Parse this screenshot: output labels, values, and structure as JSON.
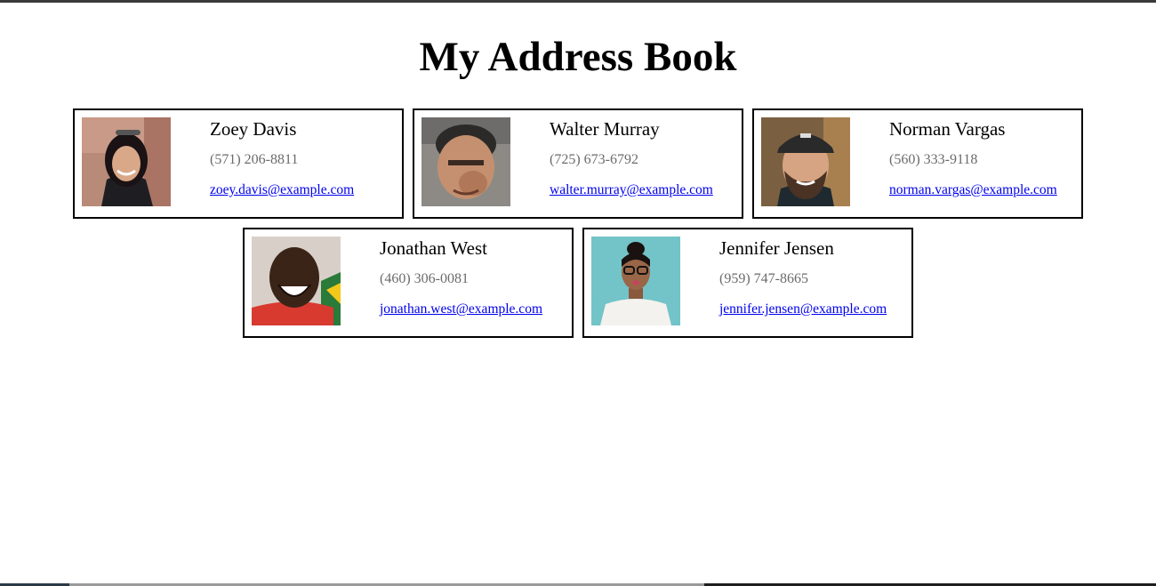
{
  "page": {
    "title": "My Address Book"
  },
  "contacts": [
    {
      "name": "Zoey Davis",
      "phone": "(571) 206-8811",
      "email": "zoey.davis@example.com",
      "photo_icon": "person-photo"
    },
    {
      "name": "Walter Murray",
      "phone": "(725) 673-6792",
      "email": "walter.murray@example.com",
      "photo_icon": "person-photo"
    },
    {
      "name": "Norman Vargas",
      "phone": "(560) 333-9118",
      "email": "norman.vargas@example.com",
      "photo_icon": "person-photo"
    },
    {
      "name": "Jonathan West",
      "phone": "(460) 306-0081",
      "email": "jonathan.west@example.com",
      "photo_icon": "person-photo"
    },
    {
      "name": "Jennifer Jensen",
      "phone": "(959) 747-8665",
      "email": "jennifer.jensen@example.com",
      "photo_icon": "person-photo"
    }
  ],
  "colors": {
    "link": "#0000ee",
    "phone_text": "#6b6b6b",
    "card_border": "#000000"
  }
}
